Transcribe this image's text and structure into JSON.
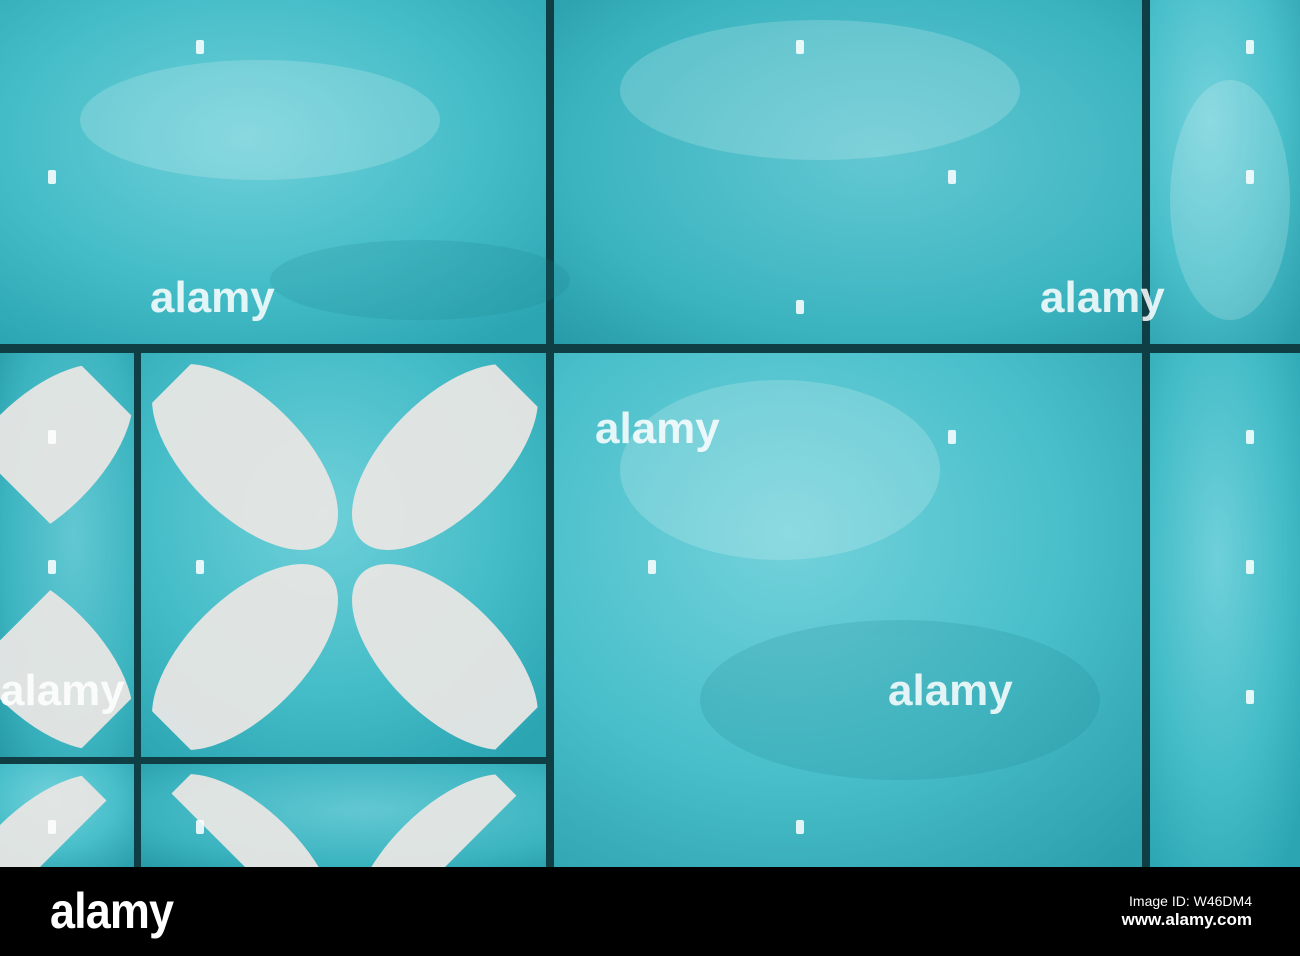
{
  "image": {
    "subject": "turquoise cement tiles with white petal pattern",
    "colors": {
      "tile_base": "#3fb8c4",
      "tile_light": "#5fcad4",
      "tile_dark": "#2aa0ad",
      "grout": "#0f3e44",
      "petal": "#e7e6e4"
    }
  },
  "watermark": {
    "text": "alamy"
  },
  "footer": {
    "logo": "alamy",
    "image_id_label": "Image ID:",
    "image_id": "W46DM4",
    "url": "www.alamy.com",
    "background": "#000000"
  }
}
